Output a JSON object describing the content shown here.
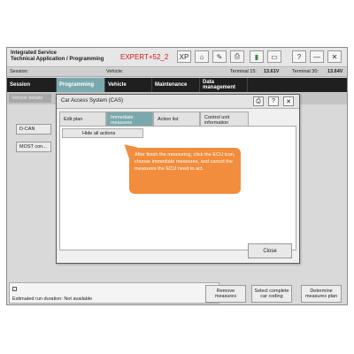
{
  "title_bar": {
    "line1": "Integrated Service",
    "line2": "Technical Application / Programming",
    "mode": "EXPERT+52_2",
    "buttons": [
      {
        "icon": "xp-icon",
        "glyph": "XP"
      },
      {
        "icon": "home-icon",
        "glyph": "⌂"
      },
      {
        "icon": "wrench-icon",
        "glyph": "✎"
      },
      {
        "icon": "print-icon",
        "glyph": "⎙"
      },
      {
        "icon": "battery-icon",
        "glyph": "▮"
      },
      {
        "icon": "window-icon",
        "glyph": "▭"
      },
      {
        "icon": "help-icon",
        "glyph": "?"
      },
      {
        "icon": "minimize-icon",
        "glyph": "—"
      },
      {
        "icon": "close-icon",
        "glyph": "✕"
      }
    ]
  },
  "info_bar": {
    "session_label": "Session:",
    "vehicle_label": "Vehicle:",
    "terminal15_label": "Terminal 15:",
    "terminal15_value": "13.61V",
    "terminal30_label": "Terminal 30:",
    "terminal30_value": "13.64V"
  },
  "tabs": {
    "session": "Session",
    "programming": "Programming",
    "vehicle": "Vehicle",
    "maintenance": "Maintenance",
    "data_management": "Data management"
  },
  "subtab": "Vehicle details",
  "left_buttons": {
    "dcan": "D-CAN",
    "most": "MOST con..."
  },
  "status": {
    "estimated": "Estimated run duration: Not available"
  },
  "bottom_buttons": {
    "remove": "Remove measures",
    "select": "Select complete car coding",
    "determine": "Determine measures plan"
  },
  "dialog": {
    "title": "Car Access System (CAS)",
    "tabs": {
      "edit_plan": "Edit plan",
      "immediate": "Immediate measures",
      "action_list": "Action list",
      "control_unit": "Control unit information"
    },
    "hide_all": "Hide all actions",
    "callout": "After finish the measuring, click the ECU icon, choose immediate measures, and cancel the measures the ECU need to act.",
    "close": "Close"
  },
  "colors": {
    "accent": "#7aa9ad",
    "mode_red": "#d01818",
    "callout_orange": "#f18d3c",
    "tabbar": "#1f1f1f"
  }
}
